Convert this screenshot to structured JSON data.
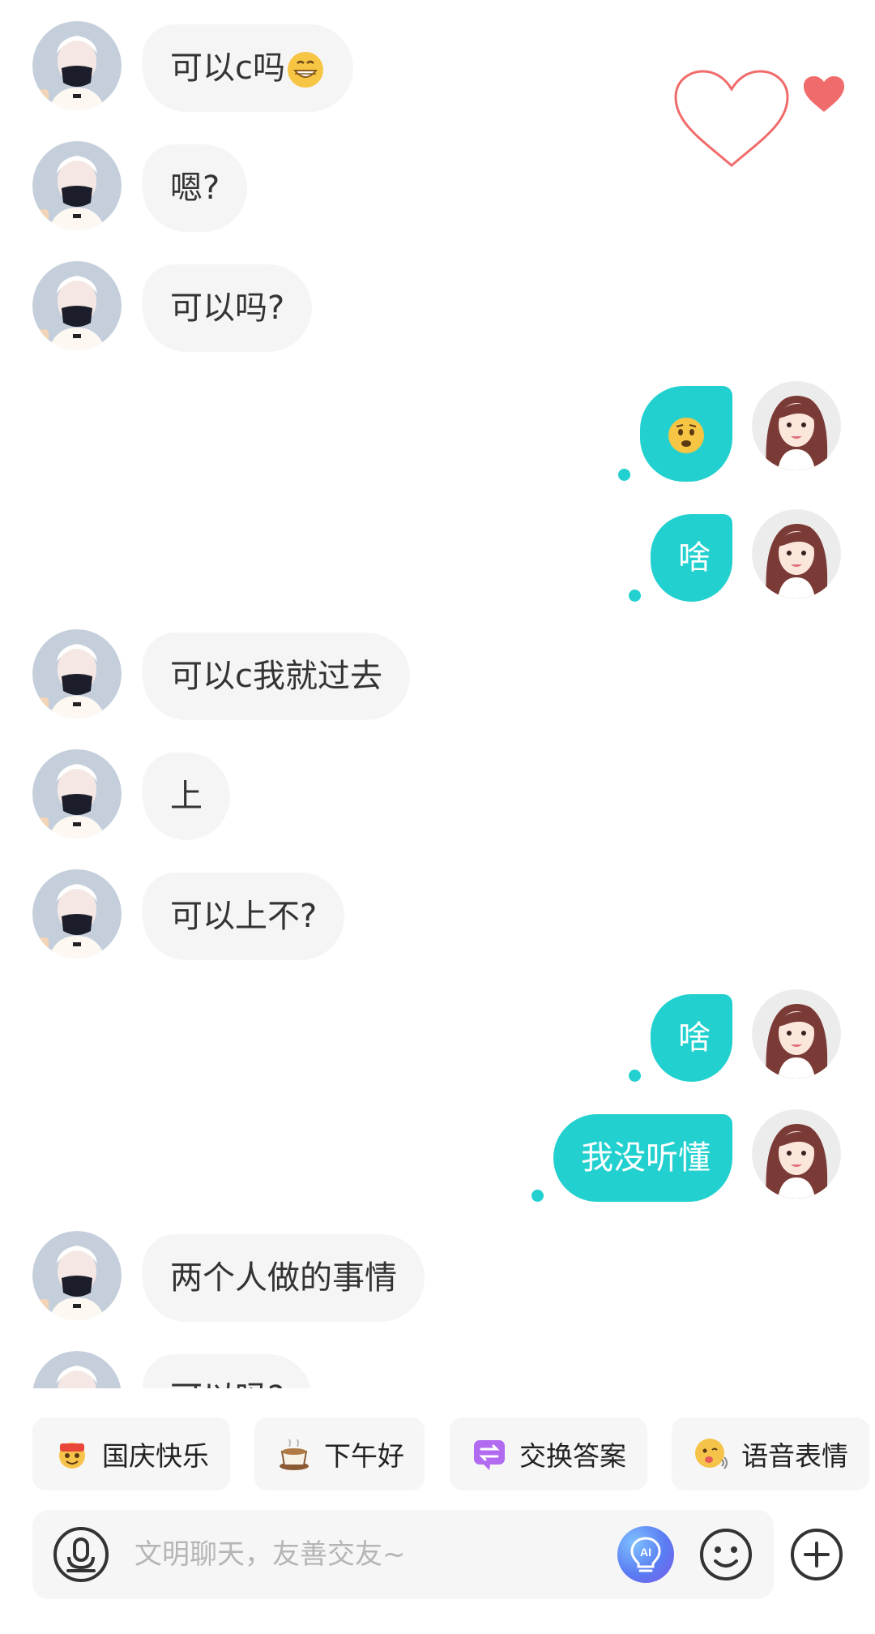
{
  "messages": [
    {
      "side": "in",
      "text": "可以c吗",
      "emoji": "grin-emoji"
    },
    {
      "side": "in",
      "text": "嗯?"
    },
    {
      "side": "in",
      "text": "可以吗?"
    },
    {
      "side": "out",
      "text": "",
      "emoji": "worried-emoji"
    },
    {
      "side": "out",
      "text": "啥"
    },
    {
      "side": "in",
      "text": "可以c我就过去"
    },
    {
      "side": "in",
      "text": "上"
    },
    {
      "side": "in",
      "text": "可以上不?"
    },
    {
      "side": "out",
      "text": "啥"
    },
    {
      "side": "out",
      "text": "我没听懂"
    },
    {
      "side": "in",
      "text": "两个人做的事情"
    },
    {
      "side": "in",
      "text": "可以吗?"
    }
  ],
  "quick_replies": [
    {
      "label": "国庆快乐",
      "icon": "festival-icon"
    },
    {
      "label": "下午好",
      "icon": "coffee-icon"
    },
    {
      "label": "交换答案",
      "icon": "exchange-icon"
    },
    {
      "label": "语音表情",
      "icon": "voice-emoji-icon"
    }
  ],
  "input": {
    "placeholder": "文明聊天，友善交友~"
  },
  "colors": {
    "accent": "#22d1cf",
    "incoming_bubble": "#f5f5f5",
    "heart": "#f06b6b"
  }
}
